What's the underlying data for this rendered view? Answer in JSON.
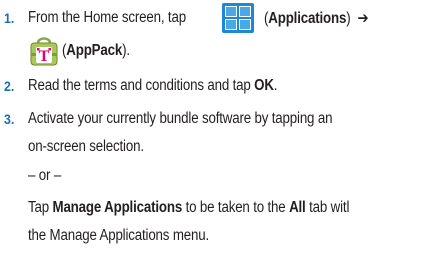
{
  "steps": [
    {
      "number": "1.",
      "line1_pre": "From the Home screen, tap",
      "line1_icon": "applications-icon",
      "line1_paren_open": "(",
      "line1_bold": "Applications",
      "line1_paren_close": ")",
      "arrow": "➔",
      "line2_icon": "appack-icon",
      "line2_paren_open": "(",
      "line2_bold": "AppPack",
      "line2_paren_close": ")."
    },
    {
      "number": "2.",
      "pre": "Read the terms and conditions and tap ",
      "bold": "OK",
      "post": "."
    },
    {
      "number": "3.",
      "line1": "Activate your currently bundle software by tapping an",
      "line2": "on-screen selection.",
      "or_text": "– or –",
      "alt_pre": "Tap ",
      "alt_bold1": "Manage Applications",
      "alt_mid": " to be taken to the ",
      "alt_bold2": "All",
      "alt_post": " tab witl",
      "alt_line2": "the Manage Applications menu."
    }
  ],
  "colors": {
    "step_number": "#1b6db5",
    "apps_icon": "#1e88d2",
    "appack_magenta": "#e20074"
  }
}
